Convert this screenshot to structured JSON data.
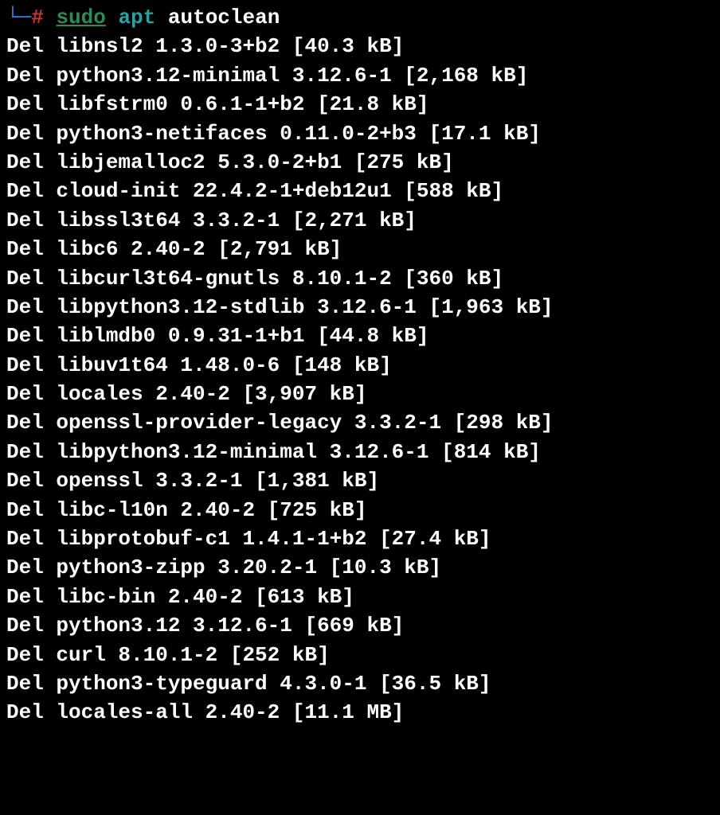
{
  "prompt": {
    "prefix": "└─",
    "hash": "#",
    "sudo": "sudo",
    "apt": "apt",
    "arg": "autoclean"
  },
  "deletions": [
    {
      "prefix": "Del",
      "pkg": "libnsl2",
      "ver": "1.3.0-3+b2",
      "size": "40.3 kB"
    },
    {
      "prefix": "Del",
      "pkg": "python3.12-minimal",
      "ver": "3.12.6-1",
      "size": "2,168 kB"
    },
    {
      "prefix": "Del",
      "pkg": "libfstrm0",
      "ver": "0.6.1-1+b2",
      "size": "21.8 kB"
    },
    {
      "prefix": "Del",
      "pkg": "python3-netifaces",
      "ver": "0.11.0-2+b3",
      "size": "17.1 kB"
    },
    {
      "prefix": "Del",
      "pkg": "libjemalloc2",
      "ver": "5.3.0-2+b1",
      "size": "275 kB"
    },
    {
      "prefix": "Del",
      "pkg": "cloud-init",
      "ver": "22.4.2-1+deb12u1",
      "size": "588 kB"
    },
    {
      "prefix": "Del",
      "pkg": "libssl3t64",
      "ver": "3.3.2-1",
      "size": "2,271 kB"
    },
    {
      "prefix": "Del",
      "pkg": "libc6",
      "ver": "2.40-2",
      "size": "2,791 kB"
    },
    {
      "prefix": "Del",
      "pkg": "libcurl3t64-gnutls",
      "ver": "8.10.1-2",
      "size": "360 kB"
    },
    {
      "prefix": "Del",
      "pkg": "libpython3.12-stdlib",
      "ver": "3.12.6-1",
      "size": "1,963 kB"
    },
    {
      "prefix": "Del",
      "pkg": "liblmdb0",
      "ver": "0.9.31-1+b1",
      "size": "44.8 kB"
    },
    {
      "prefix": "Del",
      "pkg": "libuv1t64",
      "ver": "1.48.0-6",
      "size": "148 kB"
    },
    {
      "prefix": "Del",
      "pkg": "locales",
      "ver": "2.40-2",
      "size": "3,907 kB"
    },
    {
      "prefix": "Del",
      "pkg": "openssl-provider-legacy",
      "ver": "3.3.2-1",
      "size": "298 kB"
    },
    {
      "prefix": "Del",
      "pkg": "libpython3.12-minimal",
      "ver": "3.12.6-1",
      "size": "814 kB"
    },
    {
      "prefix": "Del",
      "pkg": "openssl",
      "ver": "3.3.2-1",
      "size": "1,381 kB"
    },
    {
      "prefix": "Del",
      "pkg": "libc-l10n",
      "ver": "2.40-2",
      "size": "725 kB"
    },
    {
      "prefix": "Del",
      "pkg": "libprotobuf-c1",
      "ver": "1.4.1-1+b2",
      "size": "27.4 kB"
    },
    {
      "prefix": "Del",
      "pkg": "python3-zipp",
      "ver": "3.20.2-1",
      "size": "10.3 kB"
    },
    {
      "prefix": "Del",
      "pkg": "libc-bin",
      "ver": "2.40-2",
      "size": "613 kB"
    },
    {
      "prefix": "Del",
      "pkg": "python3.12",
      "ver": "3.12.6-1",
      "size": "669 kB"
    },
    {
      "prefix": "Del",
      "pkg": "curl",
      "ver": "8.10.1-2",
      "size": "252 kB"
    },
    {
      "prefix": "Del",
      "pkg": "python3-typeguard",
      "ver": "4.3.0-1",
      "size": "36.5 kB"
    },
    {
      "prefix": "Del",
      "pkg": "locales-all",
      "ver": "2.40-2",
      "size": "11.1 MB"
    }
  ]
}
